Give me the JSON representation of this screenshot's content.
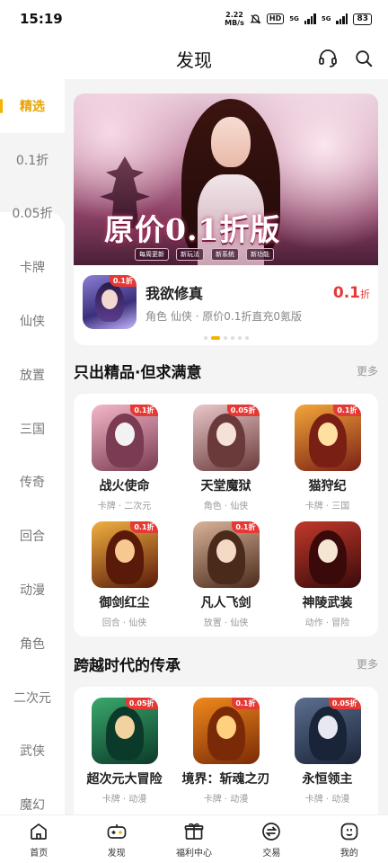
{
  "status": {
    "time": "15:19",
    "speed_value": "2.22",
    "speed_unit": "MB/s",
    "hd": "HD",
    "net1": "5G",
    "net2": "5G",
    "battery": "83"
  },
  "header": {
    "title": "发现"
  },
  "sidebar": {
    "items": [
      {
        "label": "精选",
        "active": true
      },
      {
        "label": "0.1折"
      },
      {
        "label": "0.05折"
      },
      {
        "label": "卡牌"
      },
      {
        "label": "仙侠"
      },
      {
        "label": "放置"
      },
      {
        "label": "三国"
      },
      {
        "label": "传奇"
      },
      {
        "label": "回合"
      },
      {
        "label": "动漫"
      },
      {
        "label": "角色"
      },
      {
        "label": "二次元"
      },
      {
        "label": "武侠"
      },
      {
        "label": "魔幻"
      }
    ]
  },
  "banner": {
    "headline": "原价0.1折版",
    "tags": [
      "每周更新",
      "新玩法",
      "新系统",
      "新功能"
    ],
    "game": {
      "name": "我欲修真",
      "meta": "角色 仙侠 · 原价0.1折直充0氪版",
      "discount_value": "0.1",
      "discount_unit": "折",
      "icon_badge": "0.1折"
    }
  },
  "section1": {
    "title": "只出精品·但求满意",
    "more": "更多",
    "games": [
      {
        "name": "战火使命",
        "tags": "卡牌 · 二次元",
        "badge": "0.1折"
      },
      {
        "name": "天堂魔狱",
        "tags": "角色 · 仙侠",
        "badge": "0.05折"
      },
      {
        "name": "猫狩纪",
        "tags": "卡牌 · 三国",
        "badge": "0.1折"
      },
      {
        "name": "御剑红尘",
        "tags": "回合 · 仙侠",
        "badge": "0.1折"
      },
      {
        "name": "凡人飞剑",
        "tags": "放置 · 仙侠",
        "badge": "0.1折"
      },
      {
        "name": "神陵武装",
        "tags": "动作 · 冒险",
        "badge": ""
      }
    ]
  },
  "section2": {
    "title": "跨越时代的传承",
    "more": "更多",
    "games": [
      {
        "name": "超次元大冒险",
        "tags": "卡牌 · 动漫",
        "badge": "0.05折"
      },
      {
        "name": "境界：斩魂之刃",
        "tags": "卡牌 · 动漫",
        "badge": "0.1折"
      },
      {
        "name": "永恒领主",
        "tags": "卡牌 · 动漫",
        "badge": "0.05折"
      }
    ]
  },
  "tabbar": {
    "items": [
      {
        "label": "首页"
      },
      {
        "label": "发现"
      },
      {
        "label": "福利中心"
      },
      {
        "label": "交易"
      },
      {
        "label": "我的"
      }
    ]
  },
  "colors": {
    "accent": "#f5b400",
    "discount": "#e53935"
  }
}
